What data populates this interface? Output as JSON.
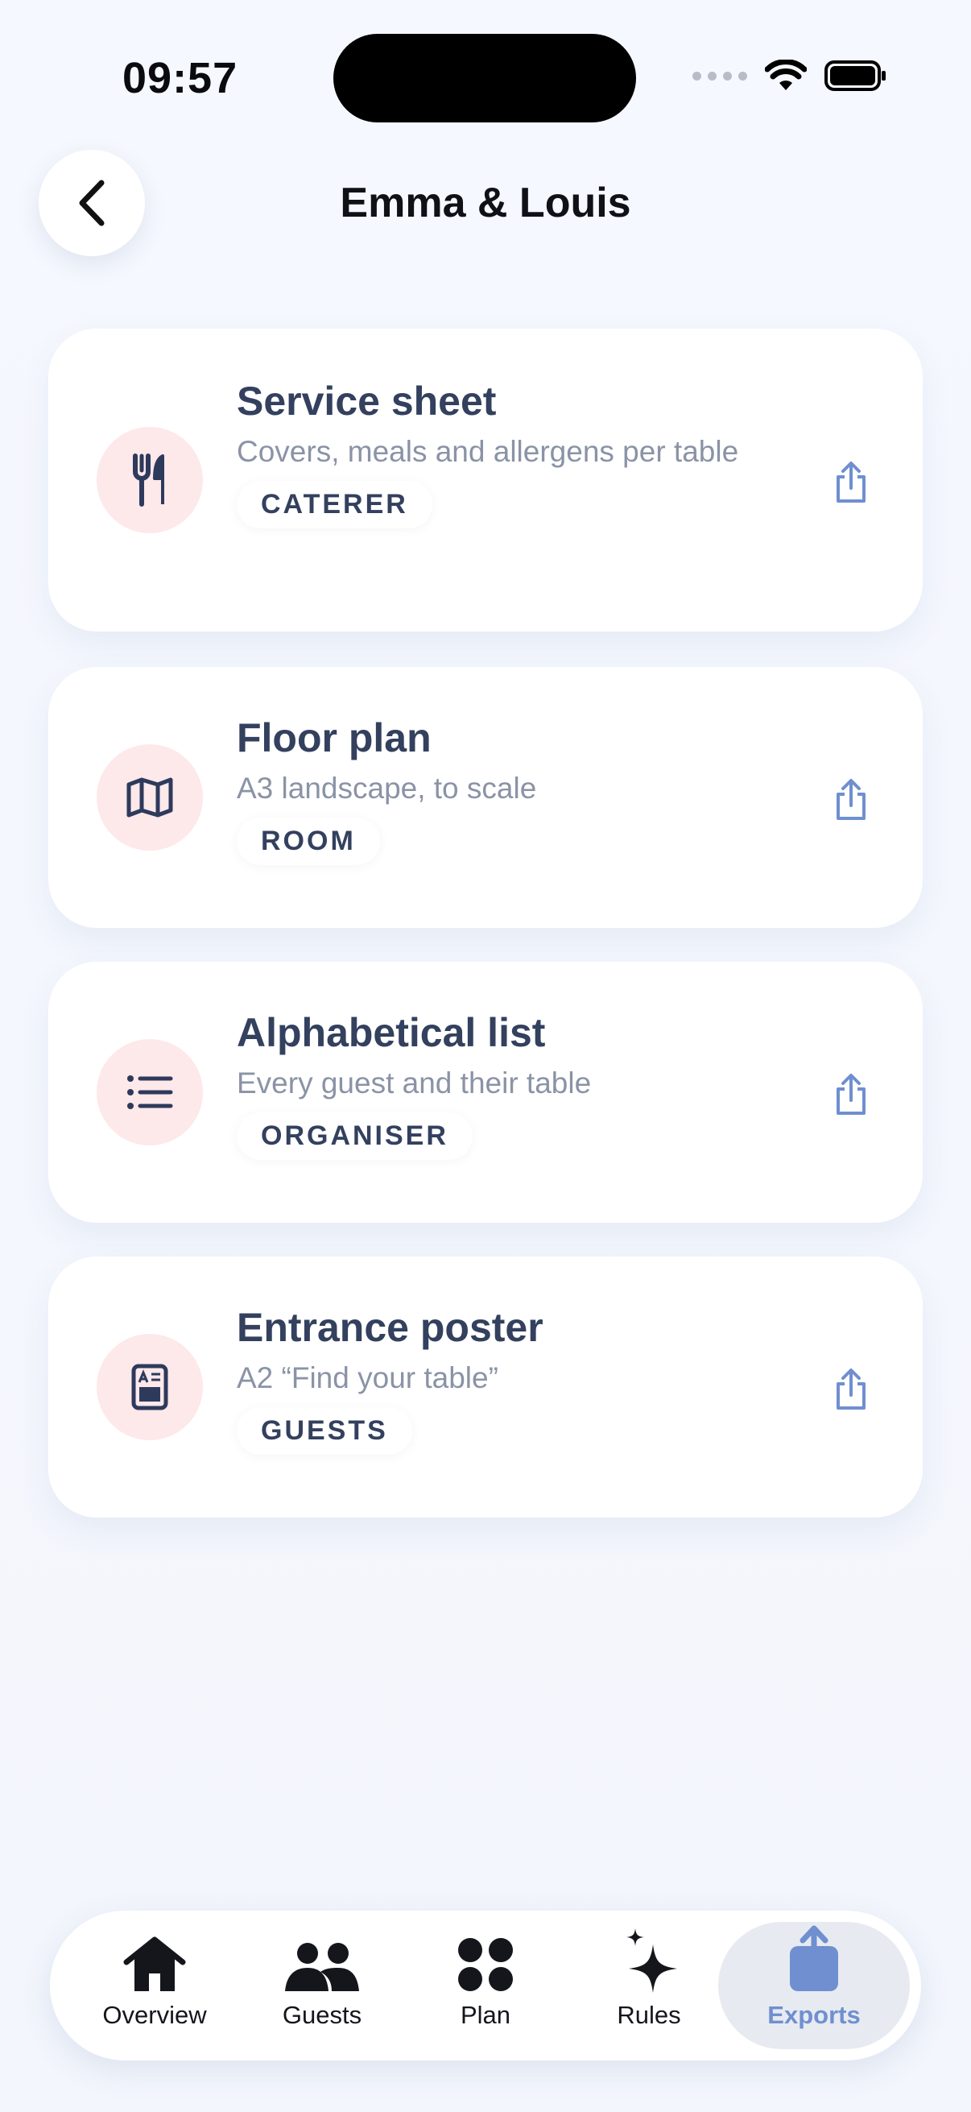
{
  "status_bar": {
    "time": "09:57"
  },
  "header": {
    "title": "Emma & Louis"
  },
  "exports": [
    {
      "title": "Service sheet",
      "description": "Covers, meals and allergens per table",
      "tag": "CATERER",
      "icon": "fork-knife-icon"
    },
    {
      "title": "Floor plan",
      "description": "A3 landscape, to scale",
      "tag": "ROOM",
      "icon": "map-icon"
    },
    {
      "title": "Alphabetical list",
      "description": "Every guest and their table",
      "tag": "ORGANISER",
      "icon": "list-icon"
    },
    {
      "title": "Entrance poster",
      "description": "A2 “Find your table”",
      "tag": "GUESTS",
      "icon": "poster-icon"
    }
  ],
  "tabbar": {
    "items": [
      {
        "label": "Overview",
        "icon": "house-icon"
      },
      {
        "label": "Guests",
        "icon": "people-icon"
      },
      {
        "label": "Plan",
        "icon": "four-dots-icon"
      },
      {
        "label": "Rules",
        "icon": "sparkles-icon"
      },
      {
        "label": "Exports",
        "icon": "share-icon",
        "active": true
      }
    ]
  },
  "colors": {
    "background": "#f4f7fd",
    "card_title": "#33405e",
    "icon_circle": "#fde8ea",
    "accent": "#6f8fd0"
  }
}
